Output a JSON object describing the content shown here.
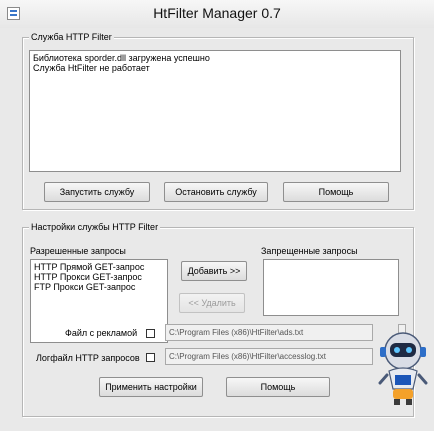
{
  "window": {
    "title": "HtFilter Manager 0.7"
  },
  "service_group": {
    "legend": "Служба HTTP Filter",
    "log_lines": [
      "Библиотека sporder.dll загружена успешно",
      "Служба HtFilter не работает"
    ],
    "buttons": {
      "start": "Запустить службу",
      "stop": "Остановить службу",
      "help": "Помощь"
    }
  },
  "settings_group": {
    "legend": "Настройки службы HTTP Filter",
    "allowed_label": "Разрешенные запросы",
    "allowed_items": [
      "HTTP Прямой GET-запрос",
      "HTTP Прокси GET-запрос",
      "FTP Прокси GET-запрос"
    ],
    "forbidden_label": "Запрещенные запросы",
    "add_button": "Добавить >>",
    "remove_button": "<< Удалить",
    "ad_file_label": "Файл с рекламой",
    "ad_file_path": "C:\\Program Files (x86)\\HtFilter\\ads.txt",
    "log_file_label": "Логфайл HTTP запросов",
    "log_file_path": "C:\\Program Files (x86)\\HtFilter\\accesslog.txt",
    "apply_button": "Применить настройки",
    "help_button": "Помощь"
  }
}
